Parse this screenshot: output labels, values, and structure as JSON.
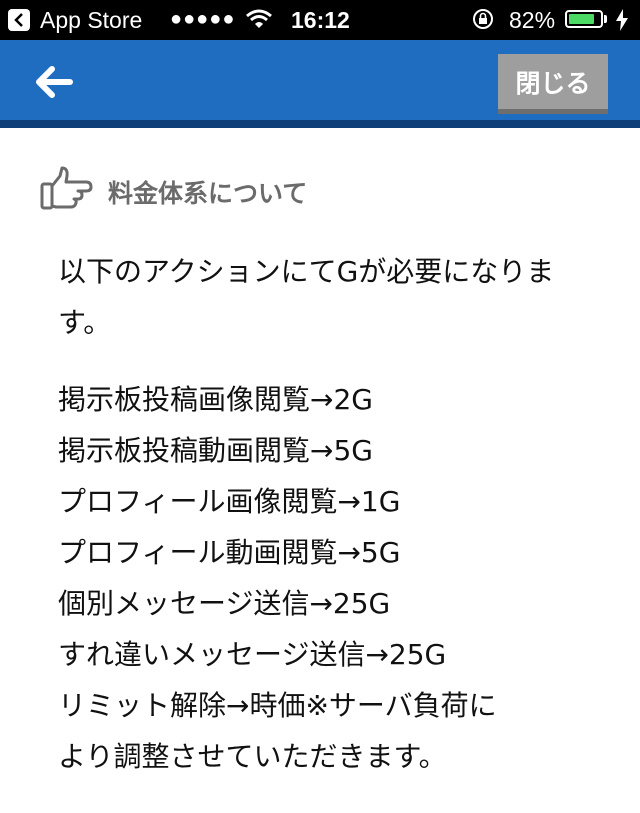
{
  "status_bar": {
    "back_app_label": "App Store",
    "signal": "●●●●●",
    "time": "16:12",
    "battery_percent": "82%",
    "battery_level": 0.82,
    "battery_color": "#4cd964"
  },
  "nav": {
    "back_icon": "arrow-left-icon",
    "close_label": "閉じる",
    "bar_color": "#1f6dc0",
    "border_color": "#0e3f78"
  },
  "section": {
    "icon": "thumbs-up-pointing-icon",
    "title": "料金体系について"
  },
  "content": {
    "intro": "以下のアクションにてGが必要になります。",
    "items": [
      "掲示板投稿画像閲覧→2G",
      "掲示板投稿動画閲覧→5G",
      "プロフィール画像閲覧→1G",
      "プロフィール動画閲覧→5G",
      "個別メッセージ送信→25G",
      "すれ違いメッセージ送信→25G",
      "リミット解除→時価※サーバ負荷に",
      "より調整させていただきます。"
    ]
  }
}
